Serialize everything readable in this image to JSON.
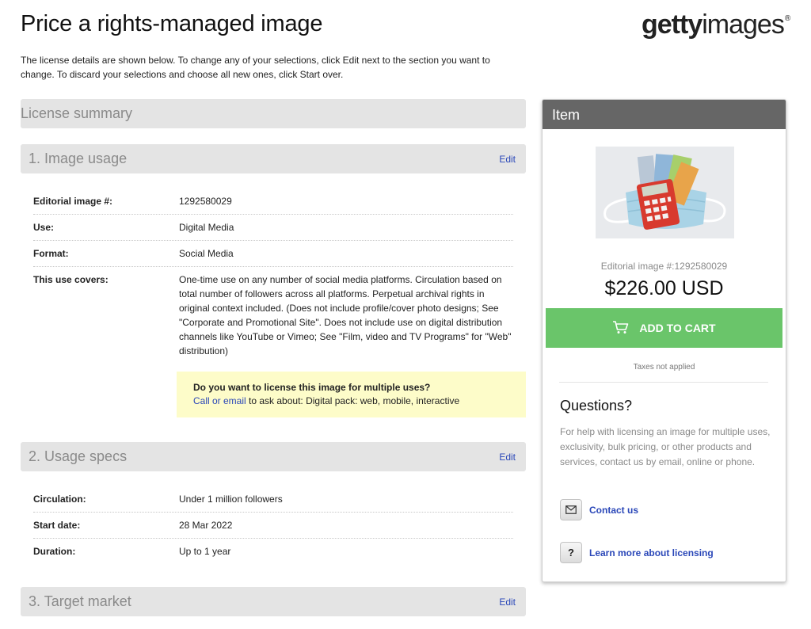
{
  "page": {
    "title": "Price a rights-managed image",
    "intro": "The license details are shown below. To change any of your selections, click Edit next to the section you want to change. To discard your selections and choose all new ones, click Start over."
  },
  "brand": {
    "name_bold": "getty",
    "name_light": "images",
    "reg": "®"
  },
  "summary": {
    "title": "License summary"
  },
  "sections": [
    {
      "title": "1. Image usage",
      "edit": "Edit",
      "rows": [
        {
          "key": "Editorial image #:",
          "value": "1292580029"
        },
        {
          "key": "Use:",
          "value": "Digital Media"
        },
        {
          "key": "Format:",
          "value": "Social Media"
        },
        {
          "key": "This use covers:",
          "value": "One-time use on any number of social media platforms. Circulation based on total number of followers across all platforms. Perpetual archival rights in original context included. (Does not include profile/cover photo designs; See \"Corporate and Promotional Site\". Does not include use on digital distribution channels like YouTube or Vimeo; See \"Film, video and TV Programs\" for \"Web\" distribution)"
        }
      ]
    },
    {
      "title": "2. Usage specs",
      "edit": "Edit",
      "rows": [
        {
          "key": "Circulation:",
          "value": "Under 1 million followers"
        },
        {
          "key": "Start date:",
          "value": "28 Mar 2022"
        },
        {
          "key": "Duration:",
          "value": "Up to 1 year"
        }
      ]
    },
    {
      "title": "3. Target market",
      "edit": "Edit"
    }
  ],
  "promo": {
    "question": "Do you want to license this image for multiple uses?",
    "link": "Call or email",
    "rest": " to ask about: Digital pack: web, mobile, interactive"
  },
  "item": {
    "header": "Item",
    "meta": "Editorial image #:1292580029",
    "price": "$226.00 USD",
    "cart_label": "ADD TO CART",
    "tax": "Taxes not applied",
    "questions_title": "Questions?",
    "questions_body": "For help with licensing an image for multiple uses, exclusivity, bulk pricing, or other products and services, contact us by email, online or phone.",
    "contact_label": "Contact us",
    "learn_icon": "?",
    "learn_label": "Learn more about licensing"
  },
  "colors": {
    "accent_link": "#2a47b8",
    "cart_green": "#6ac56a",
    "header_gray": "#666666"
  },
  "icons": [
    "cart-icon",
    "envelope-icon",
    "question-icon"
  ]
}
